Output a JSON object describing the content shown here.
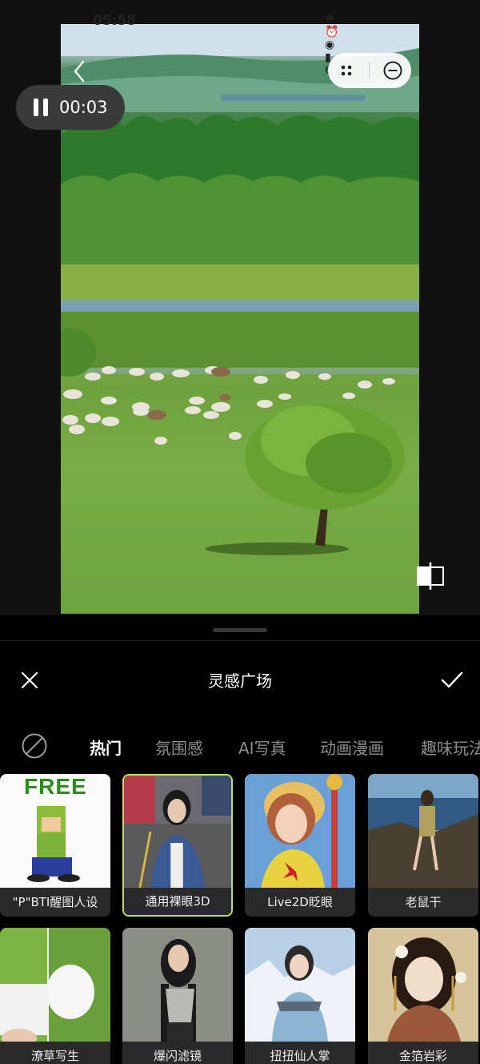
{
  "status_bar": {
    "time": "05:58",
    "icons": "✱ ⏰ ◉ ▮ 66"
  },
  "player": {
    "timer": "00:03",
    "state": "paused"
  },
  "sheet": {
    "title": "灵感广场",
    "tabs": [
      {
        "label": "热门",
        "active": true
      },
      {
        "label": "氛围感",
        "active": false
      },
      {
        "label": "AI写真",
        "active": false
      },
      {
        "label": "动画漫画",
        "active": false
      },
      {
        "label": "趣味玩法",
        "active": false
      }
    ],
    "cards": [
      {
        "label": "\"P\"BTI醒图人设",
        "badge": "FREE",
        "selected": false
      },
      {
        "label": "通用裸眼3D",
        "selected": true
      },
      {
        "label": "Live2D眨眼",
        "selected": false
      },
      {
        "label": "老鼠干",
        "selected": false
      },
      {
        "label": "潦草写生",
        "selected": false
      },
      {
        "label": "爆闪滤镜",
        "selected": false
      },
      {
        "label": "扭扭仙人掌",
        "selected": false
      },
      {
        "label": "金箔岩彩",
        "selected": false
      }
    ]
  },
  "colors": {
    "accent": "#b8e45a",
    "free_green": "#2c8c1e",
    "tab_inactive": "#8d8d8d"
  }
}
